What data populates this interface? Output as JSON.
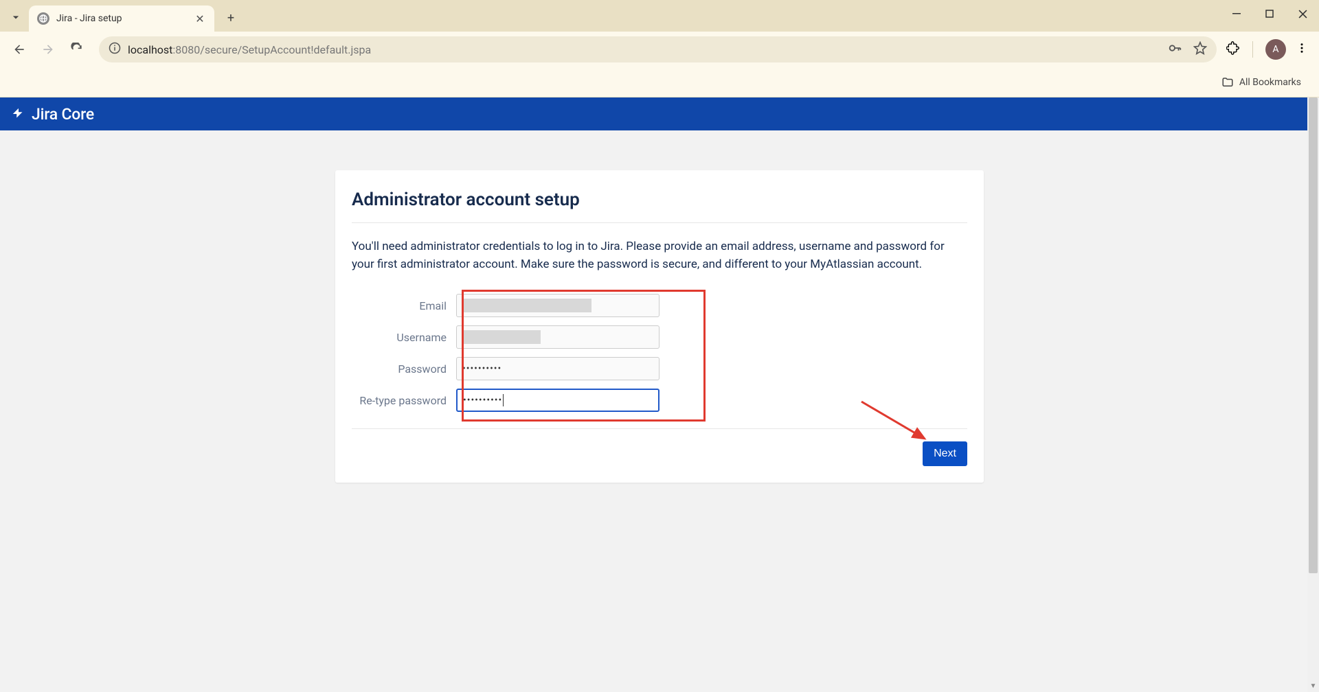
{
  "browser": {
    "tab_title": "Jira - Jira setup",
    "url_host": "localhost",
    "url_port": ":8080",
    "url_path": "/secure/SetupAccount!default.jspa",
    "avatar_letter": "A",
    "all_bookmarks": "All Bookmarks"
  },
  "jira": {
    "product_name": "Jira Core"
  },
  "page": {
    "heading": "Administrator account setup",
    "description": "You'll need administrator credentials to log in to Jira. Please provide an email address, username and password for your first administrator account. Make sure the password is secure, and different to your MyAtlassian account."
  },
  "form": {
    "email_label": "Email",
    "username_label": "Username",
    "password_label": "Password",
    "retype_label": "Re-type password",
    "password_value": "••••••••••",
    "retype_value": "••••••••••",
    "next_button": "Next"
  }
}
